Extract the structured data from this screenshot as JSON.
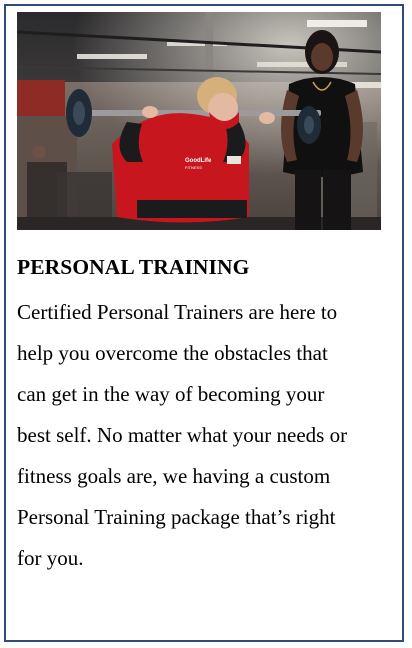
{
  "card": {
    "heading": "PERSONAL TRAINING",
    "body_lines": [
      "Certified Personal Trainers are here to",
      "help you overcome the obstacles that",
      "can get in the way of becoming your",
      "best self. No matter what your needs or",
      "fitness goals are, we having a custom",
      "Personal Training package that’s right",
      "for you."
    ],
    "photo": {
      "shirt_logo": "GoodLife",
      "shirt_logo_sub": "FITNESS"
    }
  },
  "colors": {
    "border": "#2f4c7a",
    "text": "#000000",
    "jacket_red": "#c8161e"
  }
}
